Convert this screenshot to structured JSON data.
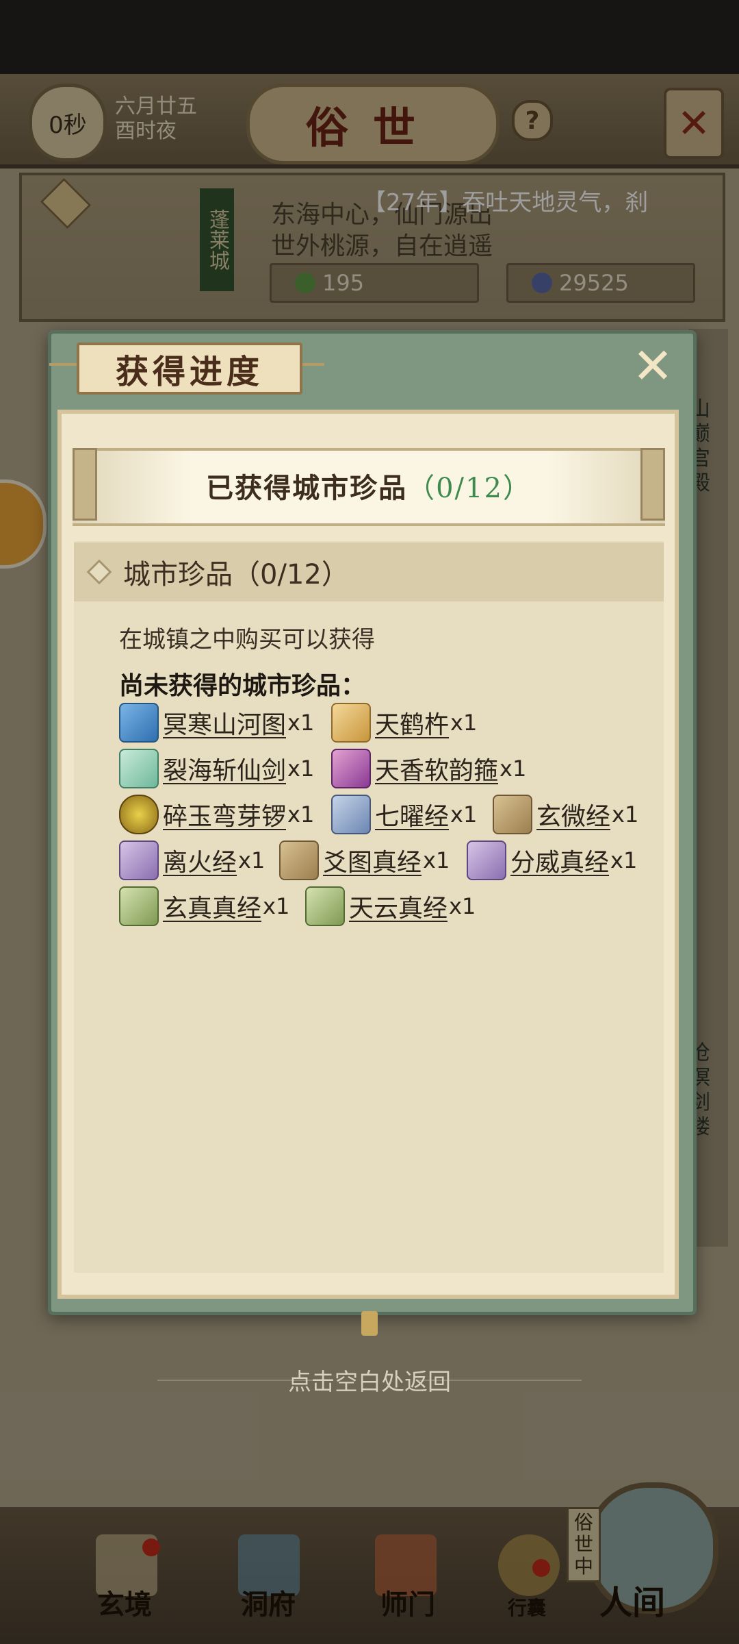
{
  "status_bar": {},
  "header": {
    "timer": "0秒",
    "date_line1": "六月廿五",
    "date_line2": "酉时夜",
    "title": "俗世",
    "help": "?"
  },
  "city": {
    "banner": "蓬莱城",
    "ticker": "【27年】吞吐天地灵气，刹",
    "desc_line1": "东海中心，仙门源出",
    "desc_line2": "世外桃源，自在逍遥",
    "leaf_value": "195",
    "coin_value": "29525"
  },
  "side": {
    "right_top": "山巅宫殿",
    "right_bottom": "沧溟剑楼"
  },
  "modal": {
    "title": "获得进度",
    "ribbon_label": "已获得城市珍品",
    "ribbon_count": "（0/12）",
    "category": "城市珍品（0/12）",
    "desc": "在城镇之中购买可以获得",
    "subheader": "尚未获得的城市珍品：",
    "items": [
      {
        "name": "冥寒山河图",
        "qty": "x1",
        "icon": "map-icon"
      },
      {
        "name": "天鹤杵",
        "qty": "x1",
        "icon": "wand-icon"
      },
      {
        "name": "裂海斩仙剑",
        "qty": "x1",
        "icon": "sword-icon"
      },
      {
        "name": "天香软韵箍",
        "qty": "x1",
        "icon": "whip-icon"
      },
      {
        "name": "碎玉弯芽锣",
        "qty": "x1",
        "icon": "gong-icon"
      },
      {
        "name": "七曜经",
        "qty": "x1",
        "icon": "scroll-icon"
      },
      {
        "name": "玄微经",
        "qty": "x1",
        "icon": "scroll-icon"
      },
      {
        "name": "离火经",
        "qty": "x1",
        "icon": "scroll-icon"
      },
      {
        "name": "爻图真经",
        "qty": "x1",
        "icon": "scroll-icon"
      },
      {
        "name": "分威真经",
        "qty": "x1",
        "icon": "scroll-icon"
      },
      {
        "name": "玄真真经",
        "qty": "x1",
        "icon": "scroll-icon"
      },
      {
        "name": "天云真经",
        "qty": "x1",
        "icon": "scroll-icon"
      }
    ]
  },
  "return_hint": "点击空白处返回",
  "nav": {
    "items": [
      "玄境",
      "洞府",
      "师门",
      "行囊",
      "人间"
    ],
    "world_label": "俗世中"
  }
}
